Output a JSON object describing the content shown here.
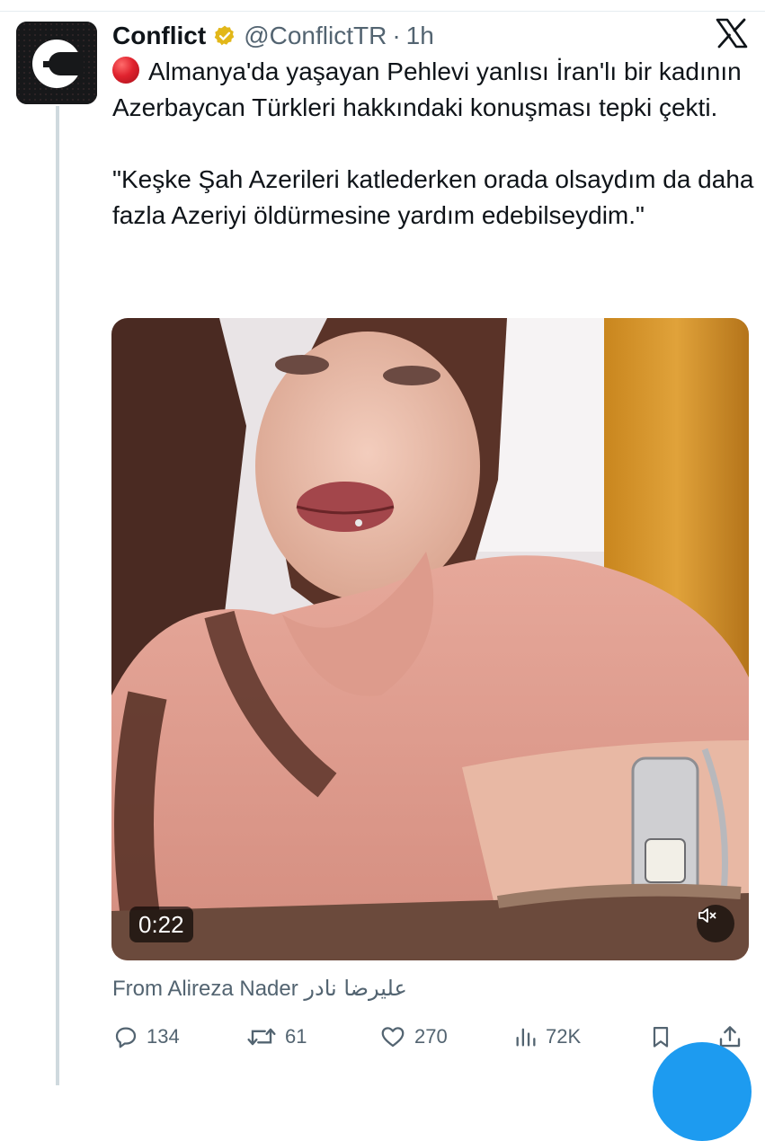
{
  "tweet": {
    "author_name": "Conflict",
    "handle": "@ConflictTR",
    "separator": "·",
    "time": "1h",
    "paragraph_1": "Almanya'da yaşayan Pehlevi yanlısı İran'lı bir kadının Azerbaycan Türkleri hakkındaki konuşması tepki çekti.",
    "paragraph_2": "\"Keşke Şah Azerileri katlederken orada olsaydım da daha fazla Azeriyi öldürmesine yardım edebilseydim.\"",
    "video_duration": "0:22",
    "from_prefix": "From",
    "from_name": "Alireza Nader",
    "from_name_arabic": "علیرضا نادر"
  },
  "actions": {
    "replies": "134",
    "reposts": "61",
    "likes": "270",
    "views": "72K"
  },
  "icons": {
    "avatar": "conflict-logo",
    "verified": "gold-verified-badge-icon",
    "platform": "x-logo-icon",
    "red_circle": "red-circle-emoji",
    "mute": "speaker-muted-icon",
    "reply": "reply-icon",
    "repost": "repost-icon",
    "like": "heart-icon",
    "views": "views-bar-chart-icon",
    "bookmark": "bookmark-icon",
    "share": "share-icon"
  },
  "colors": {
    "accent": "#1d9bf0",
    "verified_gold": "#e2b719",
    "secondary_text": "#536471"
  }
}
